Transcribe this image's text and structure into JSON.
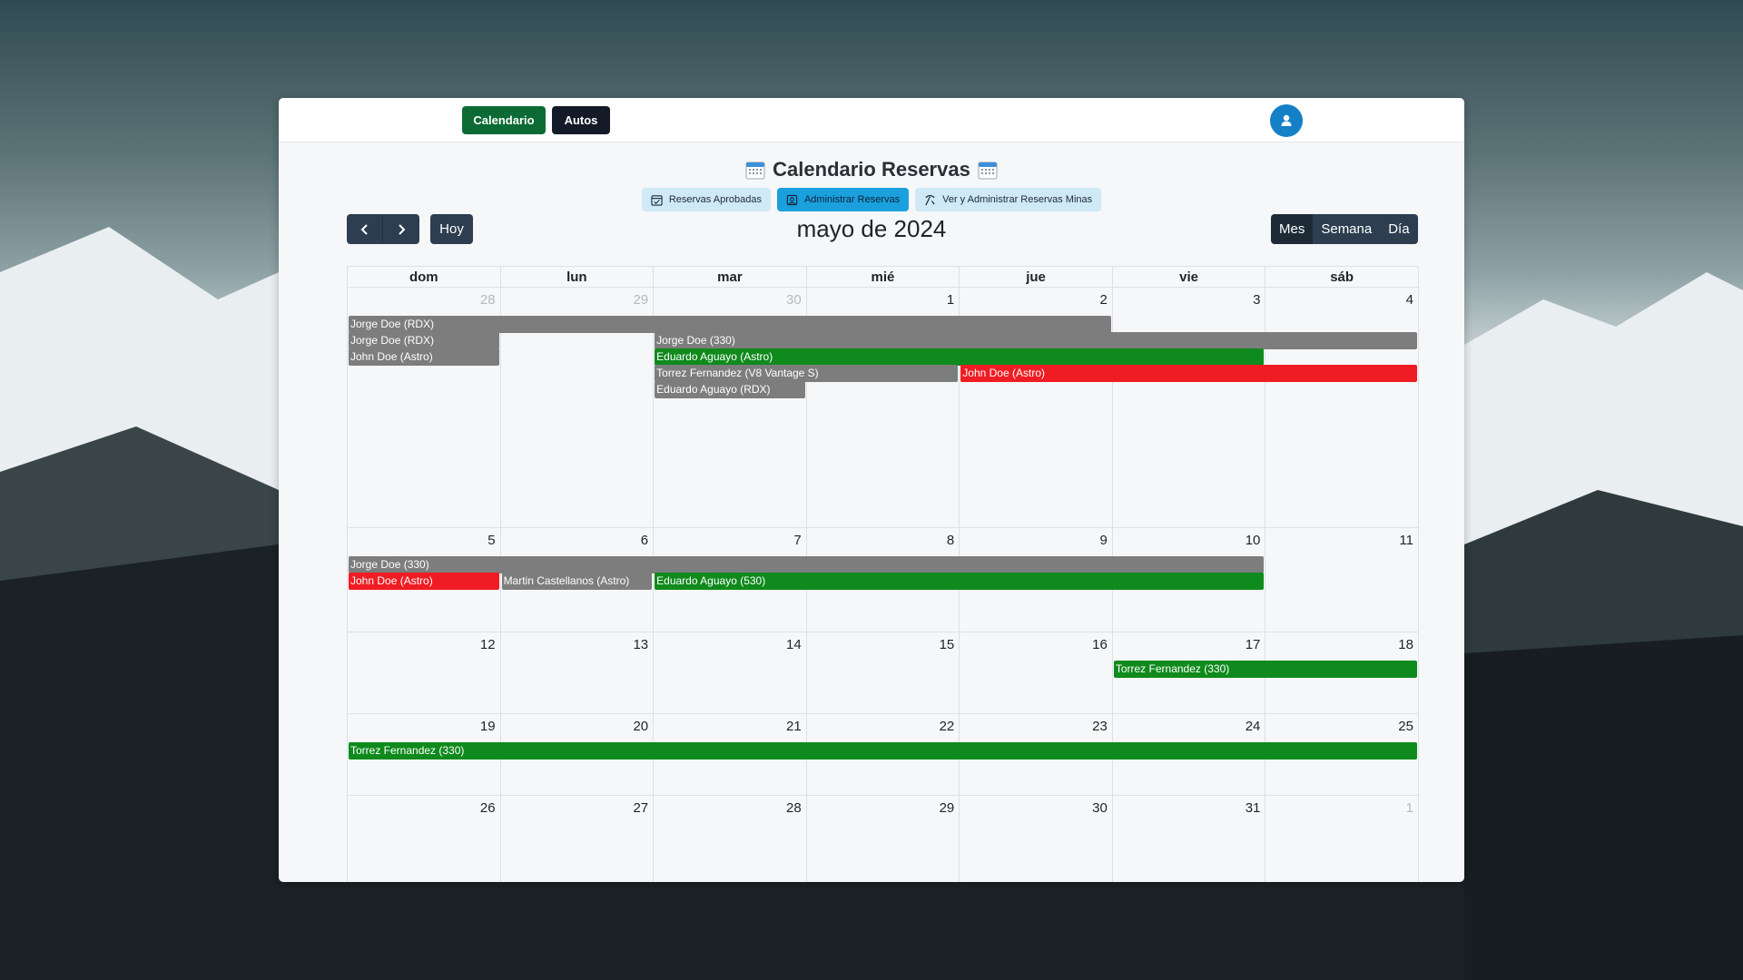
{
  "nav": {
    "calendar_label": "Calendario",
    "autos_label": "Autos",
    "avatar_icon": "user-icon"
  },
  "header": {
    "title": "Calendario Reservas"
  },
  "pills": [
    {
      "label": "Reservas Aprobadas",
      "icon": "calendar-check-icon"
    },
    {
      "label": "Administrar Reservas",
      "icon": "user-badge-icon"
    },
    {
      "label": "Ver y Administrar Reservas Minas",
      "icon": "pickaxe-icon"
    }
  ],
  "toolbar": {
    "prev_icon": "chevron-left-icon",
    "next_icon": "chevron-right-icon",
    "today_label": "Hoy",
    "month_title": "mayo de 2024",
    "views": [
      "Mes",
      "Semana",
      "Día"
    ],
    "active_view": "Mes"
  },
  "weekdays": [
    "dom",
    "lun",
    "mar",
    "mié",
    "jue",
    "vie",
    "sáb"
  ],
  "weeks": [
    {
      "days": [
        "28",
        "29",
        "30",
        "1",
        "2",
        "3",
        "4"
      ],
      "muted": [
        0,
        1,
        2
      ]
    },
    {
      "days": [
        "5",
        "6",
        "7",
        "8",
        "9",
        "10",
        "11"
      ],
      "muted": []
    },
    {
      "days": [
        "12",
        "13",
        "14",
        "15",
        "16",
        "17",
        "18"
      ],
      "muted": []
    },
    {
      "days": [
        "19",
        "20",
        "21",
        "22",
        "23",
        "24",
        "25"
      ],
      "muted": []
    },
    {
      "days": [
        "26",
        "27",
        "28",
        "29",
        "30",
        "31",
        "1"
      ],
      "muted": [
        6
      ]
    }
  ],
  "events": [
    {
      "week": 0,
      "start": 0,
      "span": 5,
      "row": 0,
      "label": "Jorge Doe (RDX)",
      "color": "gray"
    },
    {
      "week": 0,
      "start": 0,
      "span": 1,
      "row": 1,
      "label": "Jorge Doe (RDX)",
      "color": "gray"
    },
    {
      "week": 0,
      "start": 2,
      "span": 5,
      "row": 1,
      "label": "Jorge Doe (330)",
      "color": "gray"
    },
    {
      "week": 0,
      "start": 0,
      "span": 1,
      "row": 2,
      "label": "John Doe (Astro)",
      "color": "gray"
    },
    {
      "week": 0,
      "start": 2,
      "span": 4,
      "row": 2,
      "label": "Eduardo Aguayo (Astro)",
      "color": "green"
    },
    {
      "week": 0,
      "start": 2,
      "span": 2,
      "row": 3,
      "label": "Torrez Fernandez (V8 Vantage S)",
      "color": "gray"
    },
    {
      "week": 0,
      "start": 4,
      "span": 3,
      "row": 3,
      "label": "John Doe (Astro)",
      "color": "red"
    },
    {
      "week": 0,
      "start": 2,
      "span": 1,
      "row": 4,
      "label": "Eduardo Aguayo (RDX)",
      "color": "gray"
    },
    {
      "week": 1,
      "start": 0,
      "span": 6,
      "row": 0,
      "label": "Jorge Doe (330)",
      "color": "gray"
    },
    {
      "week": 1,
      "start": 0,
      "span": 1,
      "row": 1,
      "label": "John Doe (Astro)",
      "color": "red"
    },
    {
      "week": 1,
      "start": 1,
      "span": 1,
      "row": 1,
      "label": "Martin Castellanos (Astro)",
      "color": "gray"
    },
    {
      "week": 1,
      "start": 2,
      "span": 4,
      "row": 1,
      "label": "Eduardo Aguayo (530)",
      "color": "green"
    },
    {
      "week": 2,
      "start": 5,
      "span": 2,
      "row": 0,
      "label": "Torrez Fernandez (330)",
      "color": "green"
    },
    {
      "week": 3,
      "start": 0,
      "span": 7,
      "row": 0,
      "label": "Torrez Fernandez (330)",
      "color": "green"
    }
  ]
}
